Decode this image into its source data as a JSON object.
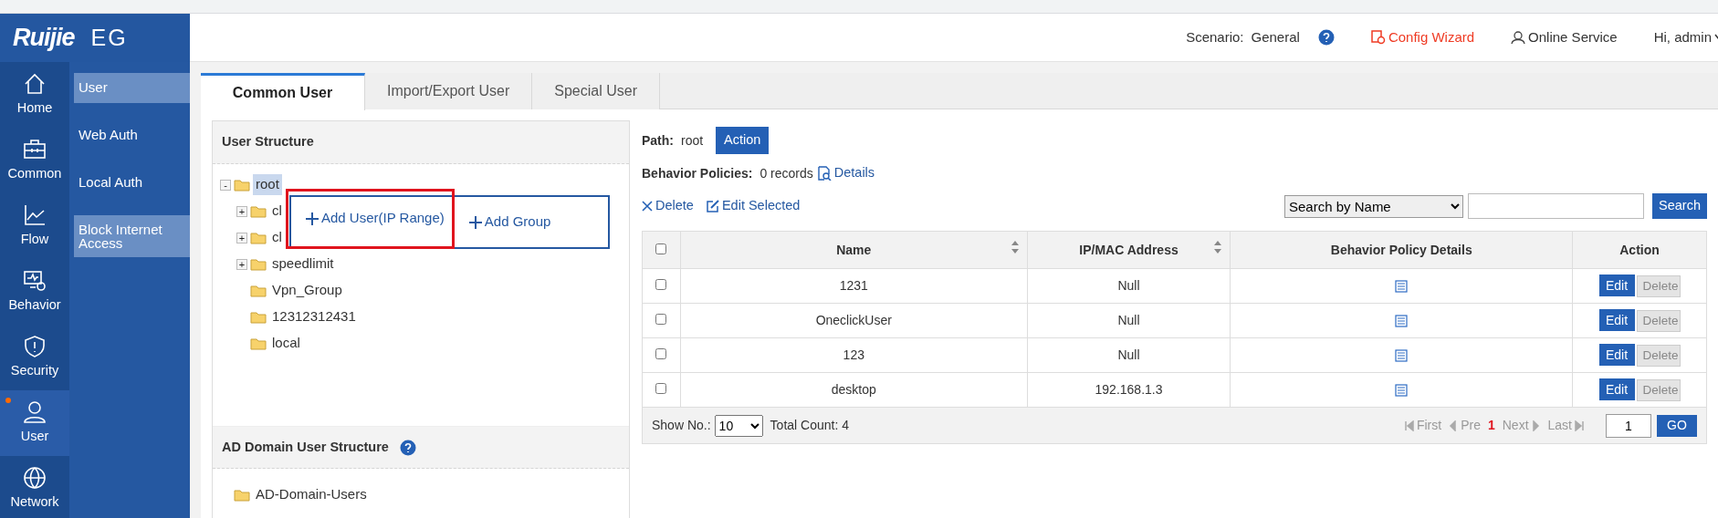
{
  "logo": {
    "brand": "Ruijie",
    "product": "EG"
  },
  "header": {
    "scenario_label": "Scenario:",
    "scenario": "General",
    "config_wizard": "Config Wizard",
    "online_service": "Online Service",
    "greeting": "Hi, admin"
  },
  "nav": [
    {
      "label": "Home",
      "kind": "home",
      "selected": false,
      "dot": false
    },
    {
      "label": "Common",
      "kind": "toolbox",
      "selected": false,
      "dot": false
    },
    {
      "label": "Flow",
      "kind": "chart",
      "selected": false,
      "dot": false
    },
    {
      "label": "Behavior",
      "kind": "monitor",
      "selected": false,
      "dot": false
    },
    {
      "label": "Security",
      "kind": "shield",
      "selected": false,
      "dot": false
    },
    {
      "label": "User",
      "kind": "person",
      "selected": true,
      "dot": true
    },
    {
      "label": "Network",
      "kind": "globe",
      "selected": false,
      "dot": false
    }
  ],
  "submenu": [
    {
      "label": "User",
      "highlighted": true
    },
    {
      "label": "Web Auth",
      "highlighted": false
    },
    {
      "label": "Local Auth",
      "highlighted": false
    },
    {
      "label": "Block Internet Access",
      "highlighted": true
    }
  ],
  "tabs": [
    {
      "label": "Common User",
      "selected": true
    },
    {
      "label": "Import/Export User",
      "selected": false
    },
    {
      "label": "Special User",
      "selected": false
    }
  ],
  "user_structure": {
    "title": "User Structure",
    "tree": [
      {
        "label": "root",
        "toggle": "-",
        "selected": true,
        "children": [
          {
            "label": "cl",
            "toggle": "+",
            "selected": false
          },
          {
            "label": "cl",
            "toggle": "+",
            "selected": false
          },
          {
            "label": "speedlimit",
            "toggle": "+",
            "selected": false
          },
          {
            "label": "Vpn_Group",
            "selected": false
          },
          {
            "label": "12312312431",
            "selected": false
          },
          {
            "label": "local",
            "selected": false
          }
        ]
      }
    ]
  },
  "popup": {
    "items": [
      {
        "label": "Add User(IP Range)",
        "outlined": true
      },
      {
        "label": "Add Group",
        "outlined": false
      }
    ]
  },
  "ad_structure": {
    "title": "AD Domain User Structure",
    "tree": [
      {
        "label": "AD-Domain-Users"
      }
    ]
  },
  "path": {
    "label": "Path:",
    "value": "root",
    "action": "Action"
  },
  "behavior_policies": {
    "label": "Behavior Policies:",
    "value": "0 records",
    "details": "Details"
  },
  "toolbar": {
    "delete": "Delete",
    "edit_selected": "Edit Selected",
    "search_by": "Search by Name",
    "search_button": "Search"
  },
  "table": {
    "header_checked": false,
    "columns": [
      {
        "label": "Name",
        "sortable": true
      },
      {
        "label": "IP/MAC Address",
        "sortable": true
      },
      {
        "label": "Behavior Policy Details",
        "sortable": false
      },
      {
        "label": "Action",
        "sortable": false
      }
    ],
    "rows": [
      {
        "checked": false,
        "name": "1231",
        "address": "Null",
        "edit": "Edit",
        "delete": "Delete",
        "delete_disabled": true
      },
      {
        "checked": false,
        "name": "OneclickUser",
        "address": "Null",
        "edit": "Edit",
        "delete": "Delete",
        "delete_disabled": true
      },
      {
        "checked": false,
        "name": "123",
        "address": "Null",
        "edit": "Edit",
        "delete": "Delete",
        "delete_disabled": true
      },
      {
        "checked": false,
        "name": "desktop",
        "address": "192.168.1.3",
        "edit": "Edit",
        "delete": "Delete",
        "delete_disabled": true
      }
    ]
  },
  "footer": {
    "show_label": "Show No.:",
    "page_size": "10",
    "total": "Total Count: 4",
    "pager": [
      {
        "kind": "first",
        "label": "First",
        "disabled": true
      },
      {
        "kind": "prev",
        "label": "Pre",
        "disabled": true
      },
      {
        "kind": "current",
        "label": "1",
        "disabled": false
      },
      {
        "kind": "next",
        "label": "Next",
        "disabled": true
      },
      {
        "kind": "last",
        "label": "Last",
        "disabled": true
      }
    ],
    "page": "1",
    "go": "GO"
  }
}
